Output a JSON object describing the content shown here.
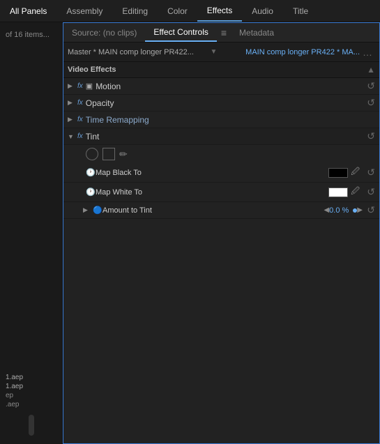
{
  "nav": {
    "items": [
      {
        "id": "all-panels",
        "label": "All Panels",
        "active": false
      },
      {
        "id": "assembly",
        "label": "Assembly",
        "active": false
      },
      {
        "id": "editing",
        "label": "Editing",
        "active": false
      },
      {
        "id": "color",
        "label": "Color",
        "active": false
      },
      {
        "id": "effects",
        "label": "Effects",
        "active": true
      },
      {
        "id": "audio",
        "label": "Audio",
        "active": false
      },
      {
        "id": "title",
        "label": "Title",
        "active": false
      }
    ]
  },
  "panel": {
    "tabs": [
      {
        "id": "source",
        "label": "Source: (no clips)",
        "active": false
      },
      {
        "id": "effect-controls",
        "label": "Effect Controls",
        "active": true
      },
      {
        "id": "metadata",
        "label": "Metadata",
        "active": false
      }
    ],
    "tab_menu": "≡",
    "comp_source": "Master * MAIN comp longer PR422...",
    "comp_arrow": "▼",
    "comp_target": "MAIN comp longer PR422 * MA...",
    "comp_menu": "…",
    "section_label": "Video Effects",
    "scroll_btn": "▲"
  },
  "effects": [
    {
      "id": "motion",
      "expanded": false,
      "fx": "fx",
      "icon": "■",
      "name": "Motion",
      "has_reset": true,
      "reset_icon": "↺"
    },
    {
      "id": "opacity",
      "expanded": false,
      "fx": "fx",
      "name": "Opacity",
      "has_reset": true,
      "reset_icon": "↺"
    },
    {
      "id": "time-remapping",
      "expanded": false,
      "fx": "fx",
      "name": "Time Remapping",
      "name_style": "italic_blue",
      "has_reset": false
    },
    {
      "id": "tint",
      "expanded": true,
      "fx": "fx",
      "name": "Tint",
      "has_reset": true,
      "reset_icon": "↺",
      "sub": {
        "shapes": [
          "circle",
          "rect",
          "brush"
        ],
        "map_black": {
          "label": "Map Black To",
          "color": "#000000",
          "has_reset": true,
          "reset_icon": "↺"
        },
        "map_white": {
          "label": "Map White To",
          "color": "#ffffff",
          "has_reset": true,
          "reset_icon": "↺"
        },
        "amount": {
          "label": "Amount to Tint",
          "value": "0.0 %",
          "has_reset": true,
          "reset_icon": "↺"
        }
      }
    }
  ],
  "sidebar": {
    "count_label": "of 16 items...",
    "files": [
      {
        "name": "1.aep",
        "highlight": true
      },
      {
        "name": "1.aep",
        "highlight": true
      },
      {
        "name": "ep",
        "highlight": false
      },
      {
        "name": ".aep",
        "highlight": false
      }
    ]
  }
}
